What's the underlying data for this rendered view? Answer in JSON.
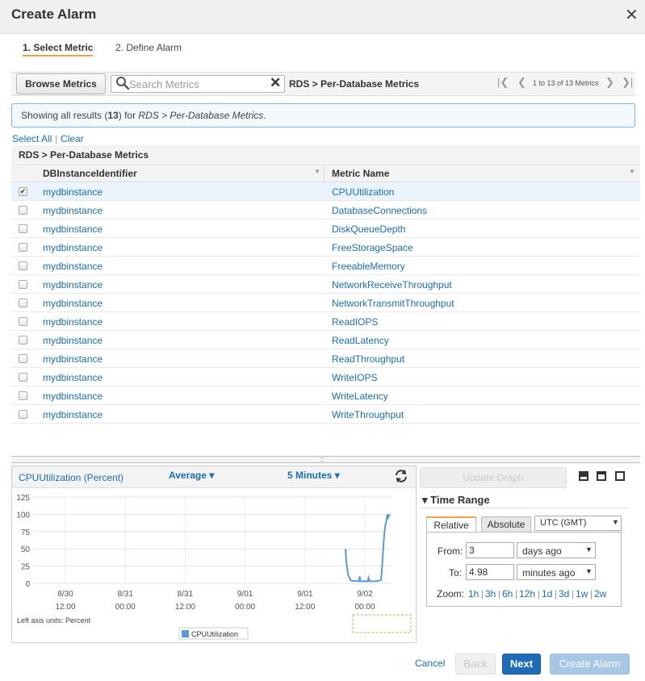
{
  "dialog": {
    "title": "Create Alarm"
  },
  "steps": [
    "1. Select Metric",
    "2. Define Alarm"
  ],
  "toolbar": {
    "browse_label": "Browse Metrics",
    "search_placeholder": "Search Metrics",
    "breadcrumb": "RDS > Per-Database Metrics",
    "pager_text": "1 to 13 of 13 Metrics"
  },
  "info": {
    "prefix": "Showing all results (",
    "count": "13",
    "middle": ") for ",
    "path": "RDS > Per-Database Metrics",
    "suffix": "."
  },
  "selection": {
    "select_all": "Select All",
    "separator": "|",
    "clear": "Clear"
  },
  "table": {
    "group_title": "RDS > Per-Database Metrics",
    "columns": [
      "DBInstanceIdentifier",
      "Metric Name"
    ],
    "rows": [
      {
        "instance": "mydbinstance",
        "metric": "CPUUtilization",
        "checked": true
      },
      {
        "instance": "mydbinstance",
        "metric": "DatabaseConnections",
        "checked": false
      },
      {
        "instance": "mydbinstance",
        "metric": "DiskQueueDepth",
        "checked": false
      },
      {
        "instance": "mydbinstance",
        "metric": "FreeStorageSpace",
        "checked": false
      },
      {
        "instance": "mydbinstance",
        "metric": "FreeableMemory",
        "checked": false
      },
      {
        "instance": "mydbinstance",
        "metric": "NetworkReceiveThroughput",
        "checked": false
      },
      {
        "instance": "mydbinstance",
        "metric": "NetworkTransmitThroughput",
        "checked": false
      },
      {
        "instance": "mydbinstance",
        "metric": "ReadIOPS",
        "checked": false
      },
      {
        "instance": "mydbinstance",
        "metric": "ReadLatency",
        "checked": false
      },
      {
        "instance": "mydbinstance",
        "metric": "ReadThroughput",
        "checked": false
      },
      {
        "instance": "mydbinstance",
        "metric": "WriteIOPS",
        "checked": false
      },
      {
        "instance": "mydbinstance",
        "metric": "WriteLatency",
        "checked": false
      },
      {
        "instance": "mydbinstance",
        "metric": "WriteThroughput",
        "checked": false
      }
    ]
  },
  "graph": {
    "title": "CPUUtilization (Percent)",
    "statistic": "Average",
    "period": "5 Minutes",
    "update_label": "Update Graph"
  },
  "chart_data": {
    "type": "line",
    "title": "",
    "yticks": [
      "125",
      "100",
      "75",
      "50",
      "25",
      "0"
    ],
    "ylim": [
      0,
      125
    ],
    "xticks": [
      {
        "date": "8/30",
        "time": "12:00"
      },
      {
        "date": "8/31",
        "time": "00:00"
      },
      {
        "date": "8/31",
        "time": "12:00"
      },
      {
        "date": "9/01",
        "time": "00:00"
      },
      {
        "date": "9/01",
        "time": "12:00"
      },
      {
        "date": "9/02",
        "time": "00:00"
      }
    ],
    "axis_note": "Left axis units: Percent",
    "series": [
      {
        "name": "CPUUtilization",
        "color": "#5b9bd5",
        "points": [
          [
            0.0,
            50
          ],
          [
            0.02,
            30
          ],
          [
            0.06,
            12
          ],
          [
            0.12,
            4
          ],
          [
            0.3,
            3
          ],
          [
            0.32,
            10
          ],
          [
            0.34,
            3
          ],
          [
            0.5,
            3
          ],
          [
            0.52,
            8
          ],
          [
            0.54,
            3
          ],
          [
            0.7,
            3
          ],
          [
            0.76,
            4
          ],
          [
            0.8,
            5
          ],
          [
            0.82,
            20
          ],
          [
            0.84,
            40
          ],
          [
            0.86,
            60
          ],
          [
            0.88,
            75
          ],
          [
            0.9,
            85
          ],
          [
            0.92,
            90
          ],
          [
            0.94,
            100
          ],
          [
            0.96,
            95
          ],
          [
            0.98,
            98
          ],
          [
            1.0,
            100
          ]
        ]
      }
    ],
    "grid": true,
    "legend": "bottom-center"
  },
  "time_range": {
    "heading": "Time Range",
    "tabs": [
      "Relative",
      "Absolute"
    ],
    "timezone": "UTC (GMT)",
    "from_label": "From:",
    "from_value": "3",
    "from_unit": "days ago",
    "to_label": "To:",
    "to_value": "4.98",
    "to_unit": "minutes ago",
    "zoom_label": "Zoom:",
    "zoom_options": [
      "1h",
      "3h",
      "6h",
      "12h",
      "1d",
      "3d",
      "1w",
      "2w"
    ]
  },
  "footer": {
    "cancel": "Cancel",
    "back": "Back",
    "next": "Next",
    "create": "Create Alarm"
  }
}
